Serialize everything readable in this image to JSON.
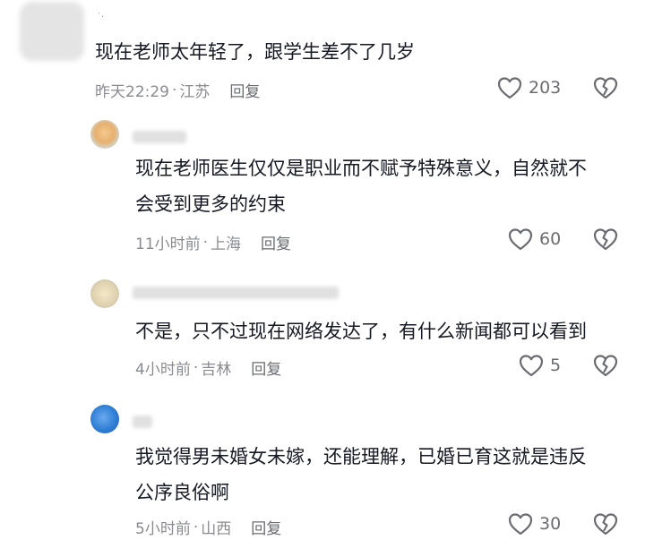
{
  "comments": [
    {
      "text_lines": [
        "现在老师太年轻了，跟学生差不了几岁"
      ],
      "time": "昨天22:29",
      "location": "江苏",
      "reply_label": "回复",
      "likes": "203"
    },
    {
      "text_lines": [
        "现在老师医生仅仅是职业而不赋予特殊意义，自然就不",
        "会受到更多的约束"
      ],
      "time": "11小时前",
      "location": "上海",
      "reply_label": "回复",
      "likes": "60"
    },
    {
      "text_lines": [
        "不是，只不过现在网络发达了，有什么新闻都可以看到"
      ],
      "time": "4小时前",
      "location": "吉林",
      "reply_label": "回复",
      "likes": "5"
    },
    {
      "text_lines": [
        "我觉得男未婚女未嫁，还能理解，已婚已育这就是违反",
        "公序良俗啊"
      ],
      "time": "5小时前",
      "location": "山西",
      "reply_label": "回复",
      "likes": "30"
    }
  ],
  "separator": "·",
  "colors": {
    "text": "#161823",
    "meta": "#8a8b91",
    "icon": "#6b6c72"
  }
}
